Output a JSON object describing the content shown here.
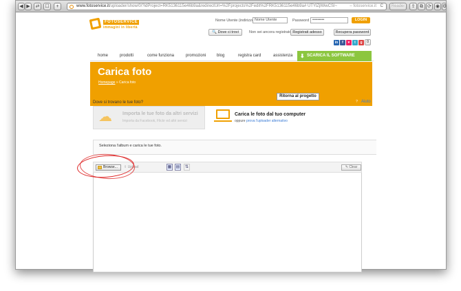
{
  "browser": {
    "url_host": "www.fotoservice.it",
    "url_path": "/uploader/show/0/?idProject=RK5136115e46b9a&redirectUrl=%2Fprojects%2Fedit%2FRK5136115e46b9a# UTYlZjlWwCSI~",
    "title_suffix": "fotoservice.it",
    "reload": "C",
    "reader": "Reader",
    "nav_buttons": [
      "◀",
      "▶",
      "⇄",
      "☐",
      "+"
    ],
    "right_buttons": [
      "⇪",
      "⧉",
      "⟳",
      "◉",
      "⚙"
    ]
  },
  "header": {
    "logo_top": "FOTOSERVICE",
    "logo_bottom": "immagini in libertà",
    "name_label": "Nome Utente (indirizzo email)",
    "name_value": "Nome Utente",
    "password_label": "Password",
    "password_value": "•••••••••",
    "login": "LOGIN",
    "dove": "Dove ci trovi",
    "register_prompt": "Non sei ancora registrato?",
    "register": "Registrati adesso",
    "recover": "Recupera password",
    "cart_count": "0",
    "social": [
      "in",
      "f",
      "♥",
      "t",
      "g"
    ]
  },
  "nav": {
    "items": [
      "home",
      "prodotti",
      "come funziona",
      "promozioni",
      "blog",
      "registra card",
      "assistenza"
    ],
    "software": "SCARICA IL SOFTWARE"
  },
  "hero": {
    "title": "Carica foto",
    "crumb_home": "Homepage",
    "crumb_current": "Carica foto",
    "back": "Ritorna al progetto"
  },
  "source": {
    "question": "Dove si trovano le tue foto?",
    "help": "Aiuto",
    "import_title": "Importa le tue foto da altri servizi",
    "import_sub": "Importa da Facebook, Flickr ed altri servizi",
    "computer_title": "Carica le foto dal tuo computer",
    "computer_sub_prefix": "oppure",
    "computer_sub_link": "prova l'uploader alternativo"
  },
  "select": {
    "text": "Seleziona l'album e carica le tue foto."
  },
  "uploader": {
    "browse": "Browse...",
    "upload": "Upload",
    "clear": "Clear"
  }
}
